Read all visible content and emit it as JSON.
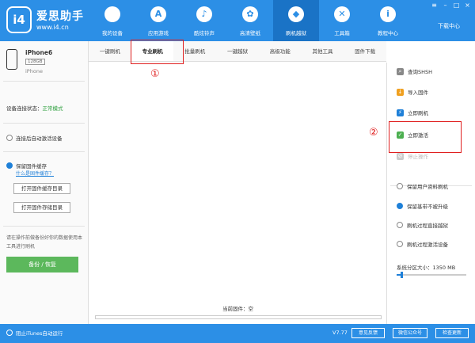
{
  "app": {
    "logo_text": "i4",
    "name": "爱思助手",
    "url": "www.i4.cn"
  },
  "nav": [
    {
      "label": "我的设备",
      "icon": "apple-icon",
      "glyph": ""
    },
    {
      "label": "应用游戏",
      "icon": "app-store-icon",
      "glyph": "A"
    },
    {
      "label": "酷炫铃声",
      "icon": "bell-icon",
      "glyph": "♪"
    },
    {
      "label": "高清壁纸",
      "icon": "flower-icon",
      "glyph": "✿"
    },
    {
      "label": "刷机越狱",
      "icon": "dropbox-icon",
      "glyph": "◆"
    },
    {
      "label": "工具箱",
      "icon": "tools-icon",
      "glyph": "✕"
    },
    {
      "label": "教程中心",
      "icon": "info-icon",
      "glyph": "i"
    }
  ],
  "window": {
    "download_center": "下载中心",
    "minimize": "–",
    "maximize": "□",
    "close": "×",
    "menu": "≡"
  },
  "device": {
    "name": "iPhone6",
    "capacity": "128GB",
    "model": "iPhone"
  },
  "left_panel": {
    "conn_label": "设备连接状态：",
    "conn_value": "正常模式",
    "auto_activate": "连接后自动激活设备",
    "keep_firmware_cache": "保留固件缓存",
    "what_is_cache": "什么是固件缓存？",
    "open_cache_dir": "打开固件缓存目录",
    "open_storage_dir": "打开固件存储目录",
    "tip": "请在操作前做备份好你的数据使用本工具进行刷机",
    "backup_restore": "备份 / 恢复"
  },
  "tabs": [
    "一键刷机",
    "专业刷机",
    "批量刷机",
    "一键越狱",
    "高级功能",
    "其他工具",
    "固件下载"
  ],
  "active_tab": 1,
  "annotations": {
    "one": "①",
    "two": "②"
  },
  "main": {
    "current_firmware": "当前固件：空",
    "progress": 0
  },
  "right_panel": {
    "actions": [
      {
        "label": "查询SHSH",
        "icon": "search-icon",
        "glyph": "⌕",
        "color": "#888888",
        "disabled": false
      },
      {
        "label": "导入固件",
        "icon": "import-icon",
        "glyph": "↓",
        "color": "#f0a020",
        "disabled": false
      },
      {
        "label": "立即刷机",
        "icon": "flash-icon",
        "glyph": "⚡",
        "color": "#1f80d8",
        "disabled": false
      },
      {
        "label": "立即激活",
        "icon": "activate-icon",
        "glyph": "✓",
        "color": "#4caf50",
        "disabled": false
      },
      {
        "label": "停止操作",
        "icon": "stop-icon",
        "glyph": "⊘",
        "color": "#cccccc",
        "disabled": true
      }
    ],
    "options": [
      {
        "label": "保留用户资料刷机",
        "checked": false
      },
      {
        "label": "保留基带不被升级",
        "checked": true
      },
      {
        "label": "刷机过程直接越狱",
        "checked": false
      },
      {
        "label": "刷机过程激活设备",
        "checked": false
      }
    ],
    "partition_label": "系统分区大小：1350 MB",
    "partition_fraction": 0.06
  },
  "statusbar": {
    "block_itunes": "阻止iTunes自动运行",
    "version": "V7.77",
    "feedback": "意见反馈",
    "wechat": "微信公众号",
    "check_update": "检查更新"
  },
  "colors": {
    "brand": "#2c8fe6",
    "highlight": "#e02020",
    "ok": "#2c9f3c",
    "backup": "#5cb85c"
  }
}
